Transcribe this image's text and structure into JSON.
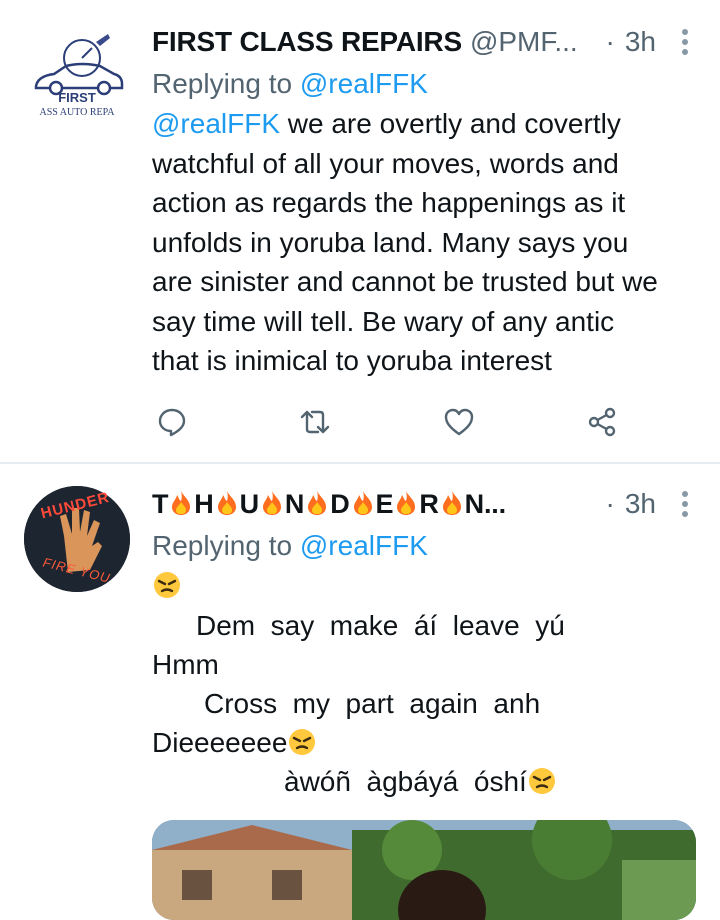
{
  "tweets": [
    {
      "display_name": "FIRST CLASS REPAIRS",
      "handle": "@PMF...",
      "dot": "·",
      "time": "3h",
      "replying_label": "Replying to ",
      "replying_handle": "@realFFK",
      "avatar_logo_text_1": "FIRST",
      "avatar_logo_text_2": "ASS AUTO REPA",
      "body_mention": "@realFFK",
      "body_lines": [
        " we are overtly and covertly",
        "watchful of all your moves, words and",
        "action as regards the happenings as it",
        "unfolds in yoruba land. Many says you",
        "are sinister and cannot be trusted but we",
        "say time will tell. Be wary of any antic",
        "that is inimical to yoruba interest"
      ]
    },
    {
      "display_name_letters": [
        "T",
        "H",
        "U",
        "N",
        "D",
        "E",
        "R",
        "N..."
      ],
      "dot": "·",
      "time": "3h",
      "replying_label": "Replying to ",
      "replying_handle": "@realFFK",
      "avatar_text_top": "HUNDER",
      "avatar_text_bottom": "FIRE YOU",
      "lines": [
        "Dem  say  make  áí  leave  yú",
        "Hmm",
        "Cross  my  part  again  anh",
        "Dieeeeeee",
        "àwóñ  àgbáyá  óshí"
      ]
    }
  ],
  "icons": {
    "reply": "reply-icon",
    "retweet": "retweet-icon",
    "like": "heart-icon",
    "share": "share-icon",
    "more": "more-vertical-icon",
    "fire": "fire-emoji-icon",
    "angry": "angry-face-emoji-icon"
  },
  "colors": {
    "link": "#1d9bf0",
    "secondary": "#536471",
    "text": "#0f1419",
    "divider": "#e6ecf0"
  }
}
